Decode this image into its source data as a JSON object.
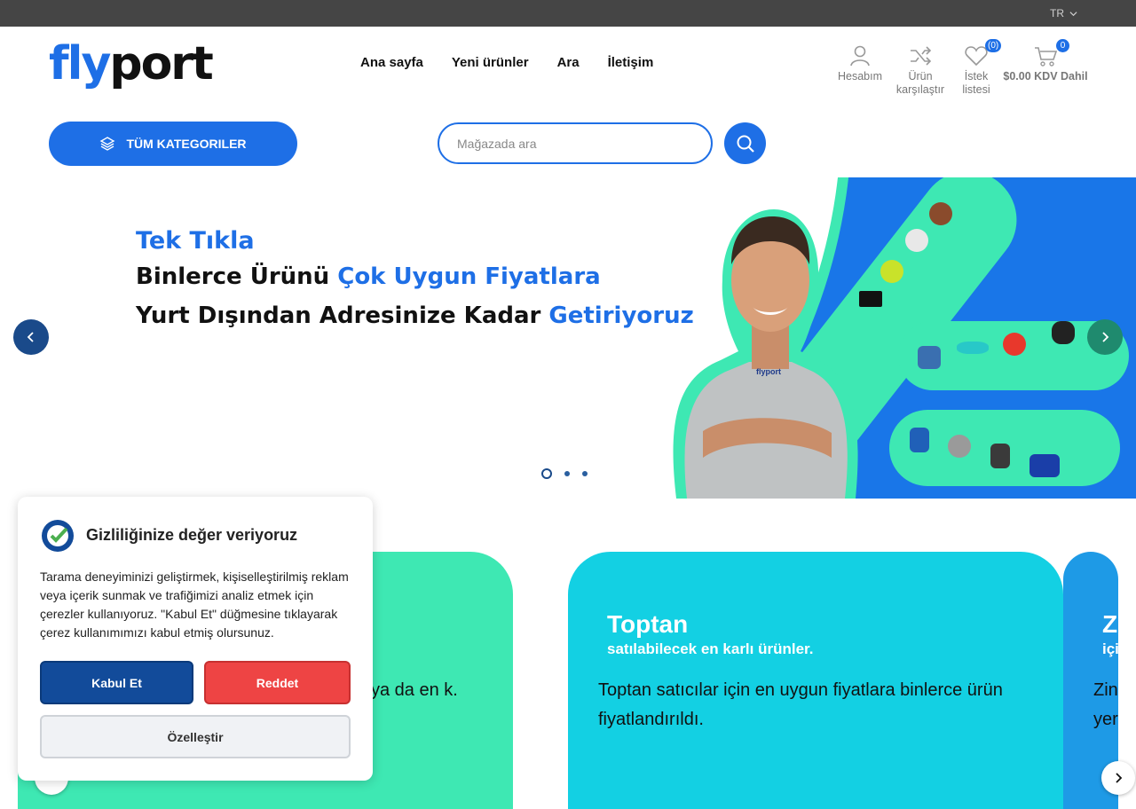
{
  "topbar": {
    "language": "TR"
  },
  "logo": {
    "part1": "fly",
    "part2": "port"
  },
  "nav": [
    {
      "label": "Ana sayfa"
    },
    {
      "label": "Yeni ürünler"
    },
    {
      "label": "Ara"
    },
    {
      "label": "İletişim"
    }
  ],
  "header_icons": {
    "account": {
      "label": "Hesabım",
      "icon": "user-icon"
    },
    "compare": {
      "label_line1": "Ürün",
      "label_line2": "karşılaştır",
      "icon": "shuffle-icon"
    },
    "wishlist": {
      "label_line1": "İstek",
      "label_line2": "listesi",
      "count": "(0)",
      "icon": "heart-icon"
    },
    "cart": {
      "count": "0",
      "total": "$0.00 KDV Dahil",
      "icon": "cart-icon"
    }
  },
  "categories_button": {
    "label": "TÜM KATEGORILER"
  },
  "search": {
    "placeholder": "Mağazada ara",
    "value": ""
  },
  "hero": {
    "line1": "Tek Tıkla",
    "line2_a": "Binlerce Ürünü ",
    "line2_b": "Çok Uygun Fiyatlara",
    "line3_a": "Yurt Dışından Adresinize Kadar ",
    "line3_b": "Getiriyoruz",
    "shirt_logo": "flyport",
    "slides": 3,
    "active_slide": 1
  },
  "cards": [
    {
      "title": "",
      "subtitle": "",
      "desc": "ya da en k."
    },
    {
      "title": "Toptan",
      "subtitle": "satılabilecek en karlı ürünler.",
      "desc": "Toptan satıcılar için en uygun fiyatlara binlerce ürün fiyatlandırıldı."
    },
    {
      "title": "Z",
      "subtitle": "içi",
      "desc": "Zin yer"
    }
  ],
  "cookie": {
    "title": "Gizliliğinize değer veriyoruz",
    "text": "Tarama deneyiminizi geliştirmek, kişiselleştirilmiş reklam veya içerik sunmak ve trafiğimizi analiz etmek için çerezler kullanıyoruz. \"Kabul Et\" düğmesine tıklayarak çerez kullanımımızı kabul etmiş olursunuz.",
    "accept": "Kabul Et",
    "reject": "Reddet",
    "customize": "Özelleştir"
  },
  "colors": {
    "brand": "#1e6fe6",
    "mint": "#3ee8b3",
    "cyan": "#13d0e3",
    "topbar": "#454545",
    "reject": "#ee4444",
    "accept": "#124b9a"
  }
}
